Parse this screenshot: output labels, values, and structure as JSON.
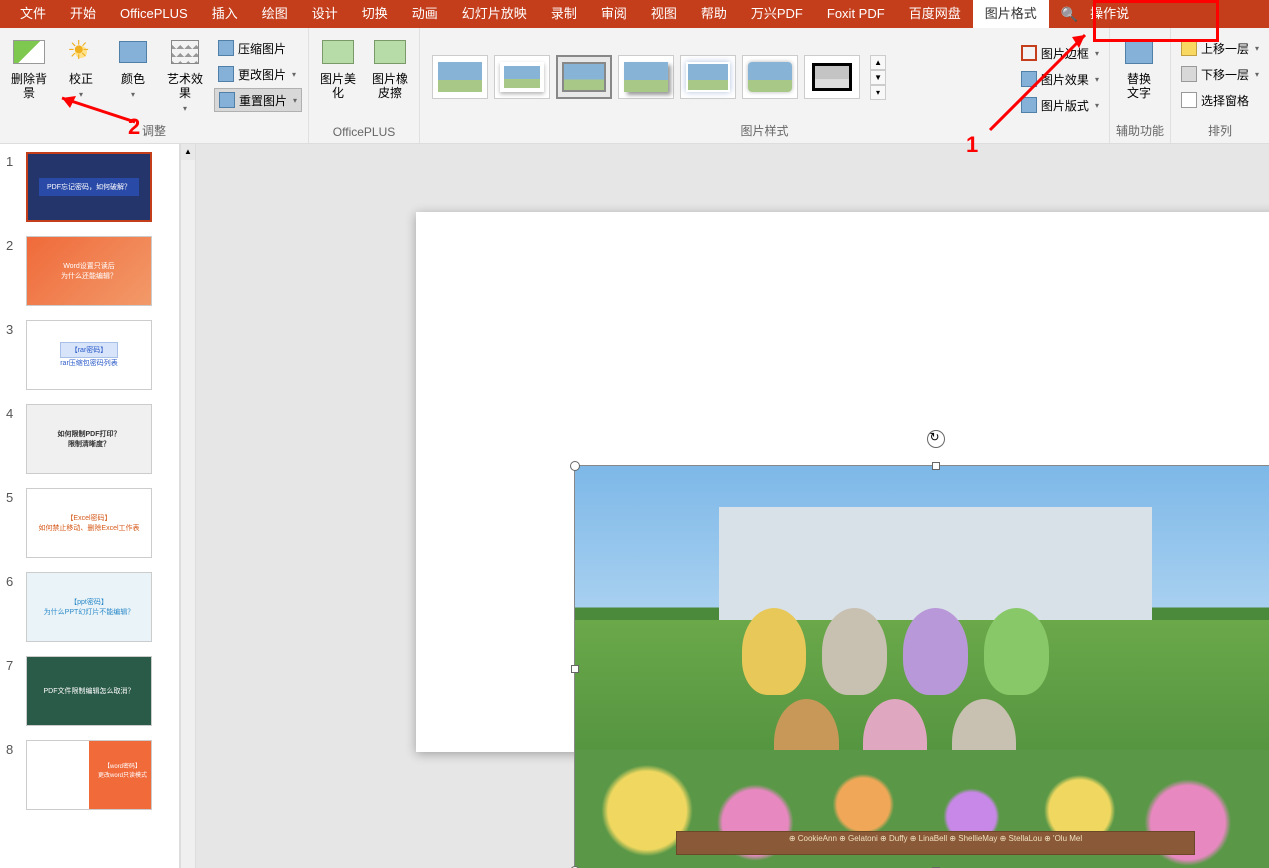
{
  "tabs": {
    "file": "文件",
    "home": "开始",
    "officeplus": "OfficePLUS",
    "insert": "插入",
    "draw": "绘图",
    "design": "设计",
    "transitions": "切换",
    "animations": "动画",
    "slideshow": "幻灯片放映",
    "record": "录制",
    "review": "审阅",
    "view": "视图",
    "help": "帮助",
    "wanxing": "万兴PDF",
    "foxit": "Foxit PDF",
    "baidu": "百度网盘",
    "picformat": "图片格式",
    "tellme": "操作说"
  },
  "ribbon": {
    "remove_bg": "删除背景",
    "corrections": "校正",
    "color": "颜色",
    "artistic": "艺术效果",
    "compress": "压缩图片",
    "change": "更改图片",
    "reset": "重置图片",
    "group_adjust": "调整",
    "beautify": "图片美化",
    "eraser": "图片橡皮擦",
    "group_officeplus": "OfficePLUS",
    "group_styles": "图片样式",
    "border": "图片边框",
    "effects": "图片效果",
    "layout": "图片版式",
    "alttext_l1": "替换",
    "alttext_l2": "文字",
    "group_access": "辅助功能",
    "bring_fwd": "上移一层",
    "send_back": "下移一层",
    "selection": "选择窗格",
    "group_arrange": "排列"
  },
  "slides": [
    {
      "n": "1",
      "txt": "PDF忘记密码，如何破解？"
    },
    {
      "n": "2",
      "txt_a": "Word设置只读后",
      "txt_b": "为什么还能编辑？"
    },
    {
      "n": "3",
      "tag": "【rar密码】",
      "txt": "rar压缩包密码列表"
    },
    {
      "n": "4",
      "txt_a": "如何限制PDF打印？",
      "txt_b": "限制清晰度？"
    },
    {
      "n": "5",
      "tag": "【Excel密码】",
      "txt": "如何禁止移动、删除Excel工作表"
    },
    {
      "n": "6",
      "tag": "【ppt密码】",
      "txt": "为什么PPT幻灯片不能编辑？"
    },
    {
      "n": "7",
      "txt": "PDF文件限制编辑怎么取消？"
    },
    {
      "n": "8",
      "tag": "【word密码】",
      "txt": "更改word只读模式"
    }
  ],
  "photo": {
    "banner": "⊕ CookieAnn  ⊕ Gelatoni  ⊕ Duffy  ⊕ LinaBell  ⊕ ShellieMay  ⊕ StellaLou  ⊕ 'Olu Mel"
  },
  "anno": {
    "one": "1",
    "two": "2"
  }
}
